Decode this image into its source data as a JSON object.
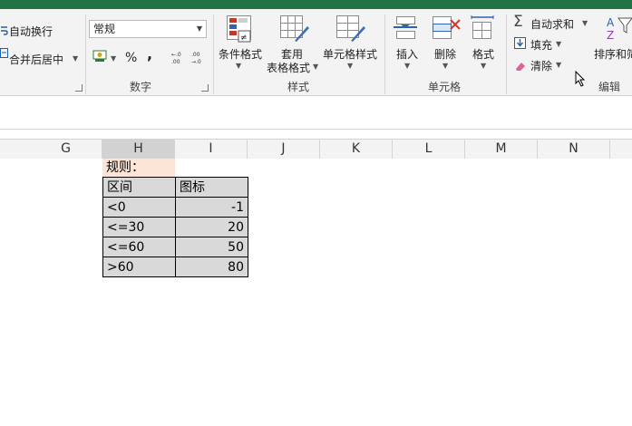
{
  "ribbon": {
    "alignment": {
      "wrap_text": "自动换行",
      "merge_center": "合并后居中"
    },
    "number": {
      "format_value": "常规",
      "percent_symbol": "%",
      "comma_symbol": ",",
      "inc_decimal": "←.0\n.00",
      "dec_decimal": ".00\n→.0",
      "group_label": "数字"
    },
    "styles": {
      "conditional_format": "条件格式",
      "table_format_line1": "套用",
      "table_format_line2": "表格格式",
      "cell_styles": "单元格样式",
      "group_label": "样式"
    },
    "cells": {
      "insert": "插入",
      "delete": "删除",
      "format": "格式",
      "group_label": "单元格"
    },
    "editing": {
      "autosum": "自动求和",
      "fill": "填充",
      "clear": "清除",
      "sort_filter": "排序和筛",
      "group_label": "编辑"
    }
  },
  "columns": [
    "G",
    "H",
    "I",
    "J",
    "K",
    "L",
    "M",
    "N"
  ],
  "sheet": {
    "rule_label": "规则：",
    "table_headers": [
      "区间",
      "图标"
    ],
    "rows": [
      [
        "<0",
        "-1"
      ],
      [
        "<=30",
        "20"
      ],
      [
        "<=60",
        "50"
      ],
      [
        ">60",
        "80"
      ]
    ]
  },
  "colors": {
    "excel_green": "#217346",
    "rule_fill": "#fce4d6",
    "table_fill": "#d9d9d9"
  }
}
